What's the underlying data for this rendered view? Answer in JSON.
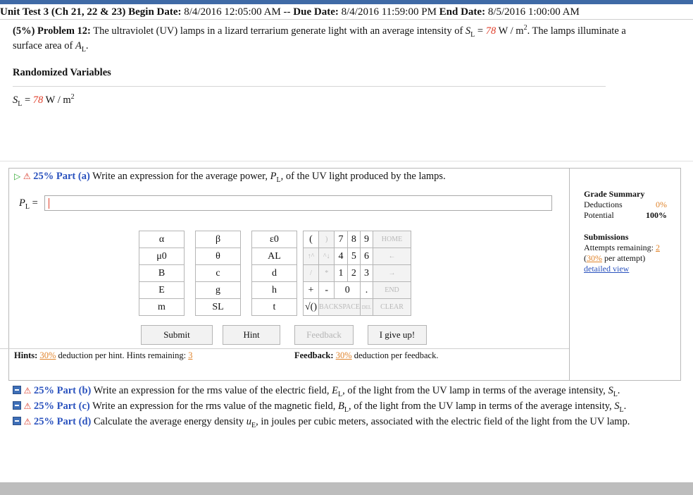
{
  "header": {
    "text_a": "Unit Test 3 (Ch 21, 22 & 23)",
    "text_b": " Begin Date: ",
    "begin": "8/4/2016 12:05:00 AM",
    "dash": " -- ",
    "text_c": "Due Date: ",
    "due": "8/4/2016 11:59:00 PM",
    "text_d": " End Date: ",
    "end": "8/5/2016 1:00:00 AM"
  },
  "problem": {
    "prefix": "(5%) Problem 12:",
    "t1": " The ultraviolet (UV) lamps in a lizard terrarium generate light with an average intensity of ",
    "sym": "S",
    "sub": "L",
    "eq": " = ",
    "value": "78",
    "unit": " W / m",
    "sup": "2",
    "t2": ". The lamps illuminate a surface area of ",
    "area_sym": "A",
    "area_sub": "L",
    "period": "."
  },
  "randomized": {
    "title": "Randomized Variables",
    "sym": "S",
    "sub": "L",
    "eq": " = ",
    "value": "78",
    "unit": " W / m",
    "sup": "2"
  },
  "part_a": {
    "label": "25% Part (a)",
    "t1": " Write an expression for the average power, ",
    "sym": "P",
    "sub": "L",
    "t2": ", of the UV light produced by the lamps.",
    "answer_sym": "P",
    "answer_sub": "L",
    "answer_eq": " = ",
    "answer_value": ""
  },
  "keypad": {
    "symbols": [
      [
        "α",
        "β",
        "ε0"
      ],
      [
        "μ0",
        "θ",
        "AL"
      ],
      [
        "B",
        "c",
        "d"
      ],
      [
        "E",
        "g",
        "h"
      ],
      [
        "m",
        "SL",
        "t"
      ]
    ],
    "r1": [
      "(",
      ")",
      "7",
      "8",
      "9",
      "HOME"
    ],
    "r2": [
      "↑^",
      "^↓",
      "4",
      "5",
      "6",
      "←"
    ],
    "r3": [
      "/",
      "*",
      "1",
      "2",
      "3",
      "→"
    ],
    "r4": [
      "+",
      "-",
      "0",
      ".",
      "END"
    ],
    "r5": [
      "√()",
      "BACKSPACE",
      "DEL",
      "CLEAR"
    ]
  },
  "buttons": {
    "submit": "Submit",
    "hint": "Hint",
    "feedback": "Feedback",
    "give_up": "I give up!"
  },
  "hints": {
    "label": "Hints:",
    "pct": "30%",
    "t1": " deduction per hint. Hints remaining: ",
    "remaining": "3"
  },
  "feedback": {
    "label": "Feedback:",
    "pct": "30%",
    "t1": " deduction per feedback."
  },
  "grade_summary": {
    "title": "Grade Summary",
    "deductions_label": "Deductions",
    "deductions_value": "0%",
    "potential_label": "Potential",
    "potential_value": "100%",
    "submissions_title": "Submissions",
    "attempts_label": "Attempts remaining: ",
    "attempts_value": "2",
    "pct_open": "(",
    "pct": "30%",
    "pct_close": " per attempt)",
    "detailed_view": "detailed view"
  },
  "other_parts": [
    {
      "label": "25% Part (b)",
      "t1": " Write an expression for the rms value of the electric field, ",
      "sym": "E",
      "sub": "L",
      "t2": ", of the light from the UV lamp in terms of the average intensity, ",
      "sym2": "S",
      "sub2": "L",
      "t3": "."
    },
    {
      "label": "25% Part (c)",
      "t1": " Write an expression for the rms value of the magnetic field, ",
      "sym": "B",
      "sub": "L",
      "t2": ", of the light from the UV lamp in terms of the average intensity, ",
      "sym2": "S",
      "sub2": "L",
      "t3": "."
    },
    {
      "label": "25% Part (d)",
      "t1": " Calculate the average energy density ",
      "sym": "u",
      "sub": "E",
      "t2": ", in joules per cubic meters, associated with the electric field of the light from the UV lamp.",
      "sym2": "",
      "sub2": "",
      "t3": ""
    }
  ],
  "colors": {
    "accent_blue": "#2a52be",
    "value_red": "#e0402c",
    "pct_orange": "#e0842c",
    "top_bar": "#3f6aa6"
  }
}
